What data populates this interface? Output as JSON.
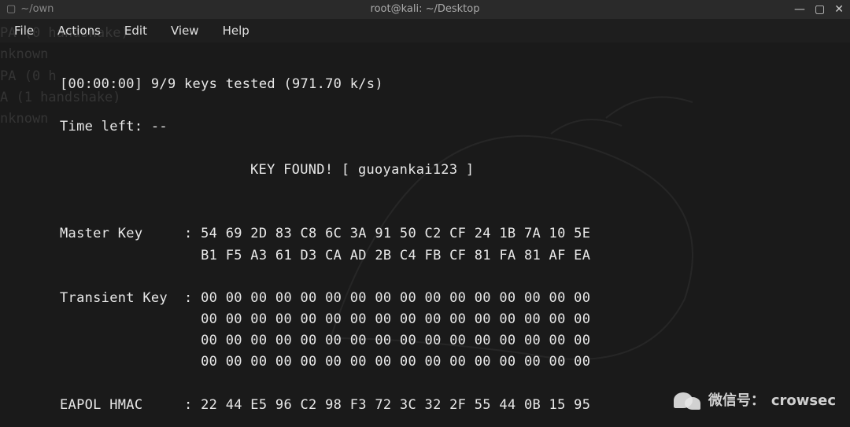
{
  "window": {
    "title": "root@kali: ~/Desktop",
    "tab_left_icon": "terminal-icon",
    "tab_left_text": "~/own"
  },
  "window_controls": {
    "minimize_glyph": "—",
    "maximize_glyph": "▢",
    "close_glyph": "✕"
  },
  "menu": {
    "file": "File",
    "actions": "Actions",
    "edit": "Edit",
    "view": "View",
    "help": "Help"
  },
  "ghost": {
    "l1": "PA (0 handshake)",
    "l2": "nknown",
    "l3": "PA (0 h",
    "l4": "A (1 handshake)",
    "l5": "nknown"
  },
  "out": {
    "line_tested": "[00:00:00] 9/9 keys tested (971.70 k/s)",
    "line_timeleft": "Time left: --",
    "key_found": "KEY FOUND! [ guoyankai123 ]",
    "master_label": "Master Key     : ",
    "master_l1": "54 69 2D 83 C8 6C 3A 91 50 C2 CF 24 1B 7A 10 5E ",
    "master_l2": "                 B1 F5 A3 61 D3 CA AD 2B C4 FB CF 81 FA 81 AF EA ",
    "transient_label": "Transient Key  : ",
    "transient_l1": "00 00 00 00 00 00 00 00 00 00 00 00 00 00 00 00 ",
    "transient_l2": "                 00 00 00 00 00 00 00 00 00 00 00 00 00 00 00 00 ",
    "transient_l3": "                 00 00 00 00 00 00 00 00 00 00 00 00 00 00 00 00 ",
    "transient_l4": "                 00 00 00 00 00 00 00 00 00 00 00 00 00 00 00 00 ",
    "eapol_label": "EAPOL HMAC     : ",
    "eapol_l1": "22 44 E5 96 C2 98 F3 72 3C 32 2F 55 44 0B 15 95 "
  },
  "watermark": {
    "label": "微信号：",
    "value": "crowsec"
  }
}
